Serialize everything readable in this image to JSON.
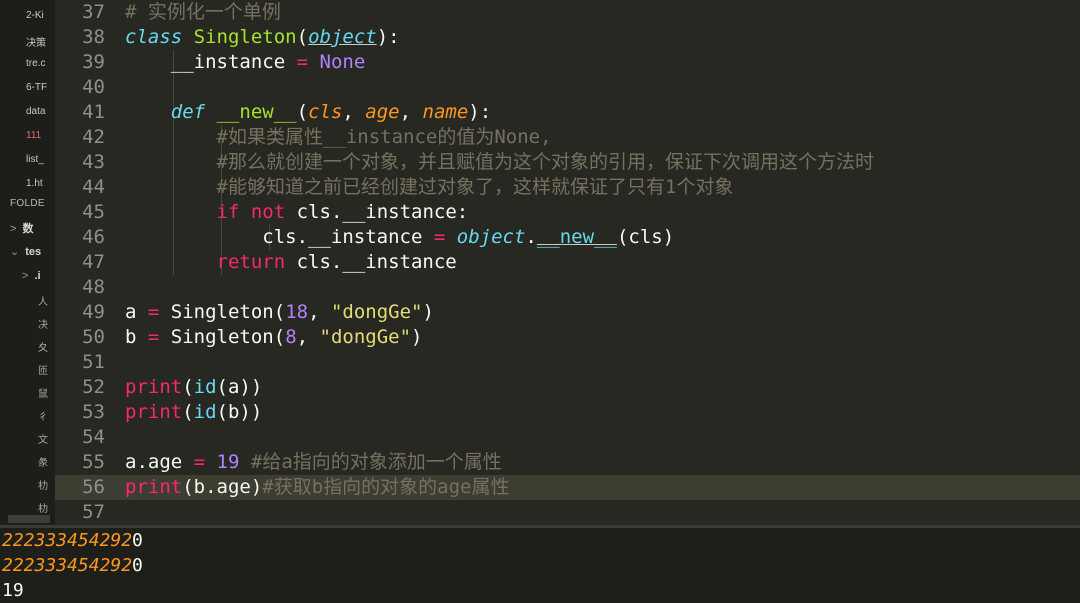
{
  "sidebar": {
    "files": [
      {
        "label": "2-Ki"
      },
      {
        "label": "决策"
      },
      {
        "label": "tre.c"
      },
      {
        "label": "6-TF"
      },
      {
        "label": "data"
      },
      {
        "label": "111"
      },
      {
        "label": "list_"
      },
      {
        "label": "1.ht"
      }
    ],
    "folders_title": "FOLDE",
    "folders": [
      {
        "chevron": ">",
        "label": "数"
      },
      {
        "chevron": "⌄",
        "label": "tes"
      },
      {
        "chevron": ">",
        "label": ".i"
      }
    ],
    "leaves": [
      "人",
      "决",
      "夊",
      "匝",
      "鼠",
      "彳",
      "文",
      "彖",
      "朸",
      "朸"
    ]
  },
  "editor": {
    "lines": [
      {
        "num": "37",
        "parts": [
          {
            "c": "cm",
            "t": "# 实例化一个单例"
          }
        ]
      },
      {
        "num": "38",
        "parts": [
          {
            "c": "st",
            "t": "class"
          },
          {
            "c": "",
            "t": " "
          },
          {
            "c": "fn",
            "t": "Singleton"
          },
          {
            "c": "",
            "t": "("
          },
          {
            "c": "st ul",
            "t": "object"
          },
          {
            "c": "",
            "t": "):"
          }
        ]
      },
      {
        "num": "39",
        "parts": [
          {
            "c": "",
            "t": "    __instance "
          },
          {
            "c": "kw",
            "t": "="
          },
          {
            "c": "",
            "t": " "
          },
          {
            "c": "num",
            "t": "None"
          }
        ]
      },
      {
        "num": "40",
        "parts": []
      },
      {
        "num": "41",
        "parts": [
          {
            "c": "",
            "t": "    "
          },
          {
            "c": "st",
            "t": "def"
          },
          {
            "c": "",
            "t": " "
          },
          {
            "c": "fn",
            "t": "__new__"
          },
          {
            "c": "",
            "t": "("
          },
          {
            "c": "it",
            "t": "cls"
          },
          {
            "c": "",
            "t": ", "
          },
          {
            "c": "it",
            "t": "age"
          },
          {
            "c": "",
            "t": ", "
          },
          {
            "c": "it",
            "t": "name"
          },
          {
            "c": "",
            "t": "):"
          }
        ]
      },
      {
        "num": "42",
        "parts": [
          {
            "c": "",
            "t": "        "
          },
          {
            "c": "cm",
            "t": "#如果类属性__instance的值为None,"
          }
        ]
      },
      {
        "num": "43",
        "parts": [
          {
            "c": "",
            "t": "        "
          },
          {
            "c": "cm",
            "t": "#那么就创建一个对象，并且赋值为这个对象的引用，保证下次调用这个方法时"
          }
        ]
      },
      {
        "num": "44",
        "parts": [
          {
            "c": "",
            "t": "        "
          },
          {
            "c": "cm",
            "t": "#能够知道之前已经创建过对象了，这样就保证了只有1个对象"
          }
        ]
      },
      {
        "num": "45",
        "parts": [
          {
            "c": "",
            "t": "        "
          },
          {
            "c": "kw",
            "t": "if"
          },
          {
            "c": "",
            "t": " "
          },
          {
            "c": "kw",
            "t": "not"
          },
          {
            "c": "",
            "t": " cls.__instance:"
          }
        ]
      },
      {
        "num": "46",
        "parts": [
          {
            "c": "",
            "t": "            cls.__instance "
          },
          {
            "c": "kw",
            "t": "="
          },
          {
            "c": "",
            "t": " "
          },
          {
            "c": "st",
            "t": "object"
          },
          {
            "c": "",
            "t": "."
          },
          {
            "c": "bi ul",
            "t": "__new__"
          },
          {
            "c": "",
            "t": "(cls)"
          }
        ]
      },
      {
        "num": "47",
        "parts": [
          {
            "c": "",
            "t": "        "
          },
          {
            "c": "kw",
            "t": "return"
          },
          {
            "c": "",
            "t": " cls.__instance"
          }
        ]
      },
      {
        "num": "48",
        "parts": []
      },
      {
        "num": "49",
        "parts": [
          {
            "c": "",
            "t": "a "
          },
          {
            "c": "kw",
            "t": "="
          },
          {
            "c": "",
            "t": " Singleton("
          },
          {
            "c": "num",
            "t": "18"
          },
          {
            "c": "",
            "t": ", "
          },
          {
            "c": "str",
            "t": "\"dongGe\""
          },
          {
            "c": "",
            "t": ")"
          }
        ]
      },
      {
        "num": "50",
        "parts": [
          {
            "c": "",
            "t": "b "
          },
          {
            "c": "kw",
            "t": "="
          },
          {
            "c": "",
            "t": " Singleton("
          },
          {
            "c": "num",
            "t": "8"
          },
          {
            "c": "",
            "t": ", "
          },
          {
            "c": "str",
            "t": "\"dongGe\""
          },
          {
            "c": "",
            "t": ")"
          }
        ]
      },
      {
        "num": "51",
        "parts": []
      },
      {
        "num": "52",
        "parts": [
          {
            "c": "kw",
            "t": "print"
          },
          {
            "c": "",
            "t": "("
          },
          {
            "c": "bi",
            "t": "id"
          },
          {
            "c": "",
            "t": "(a))"
          }
        ]
      },
      {
        "num": "53",
        "parts": [
          {
            "c": "kw",
            "t": "print"
          },
          {
            "c": "",
            "t": "("
          },
          {
            "c": "bi",
            "t": "id"
          },
          {
            "c": "",
            "t": "(b))"
          }
        ]
      },
      {
        "num": "54",
        "parts": []
      },
      {
        "num": "55",
        "parts": [
          {
            "c": "",
            "t": "a.age "
          },
          {
            "c": "kw",
            "t": "="
          },
          {
            "c": "",
            "t": " "
          },
          {
            "c": "num",
            "t": "19"
          },
          {
            "c": "",
            "t": " "
          },
          {
            "c": "cm",
            "t": "#给a指向的对象添加一个属性"
          }
        ]
      },
      {
        "num": "56",
        "current": true,
        "parts": [
          {
            "c": "kw",
            "t": "print"
          },
          {
            "c": "",
            "t": "(b.age)"
          },
          {
            "c": "cm",
            "t": "#获取b指向的对象的age属性"
          }
        ]
      },
      {
        "num": "57",
        "parts": []
      }
    ]
  },
  "output": {
    "lines": [
      {
        "hl": "222333454292",
        "tail": "0"
      },
      {
        "hl": "222333454292",
        "tail": "0"
      },
      {
        "plain": "19"
      }
    ]
  },
  "colors": {
    "editor_bg": "#272822",
    "keyword": "#f92672",
    "storage": "#66d9ef",
    "function": "#a6e22e",
    "number": "#ae81ff",
    "string": "#e6db74",
    "comment": "#75715e",
    "param": "#fd971f"
  }
}
